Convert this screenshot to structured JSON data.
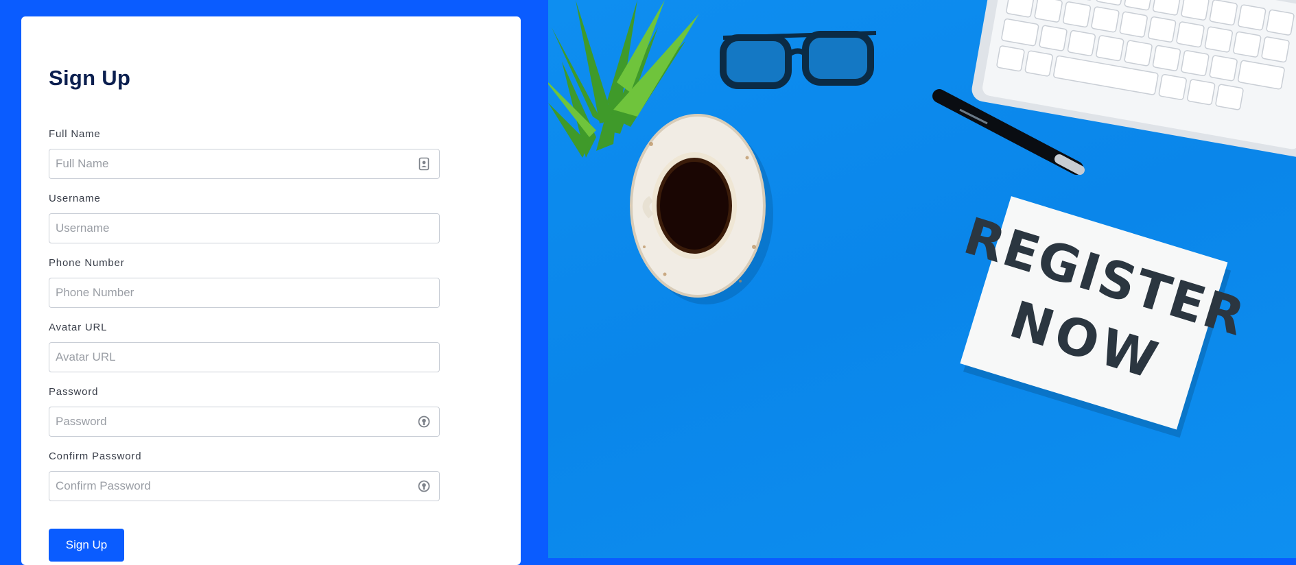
{
  "form": {
    "title": "Sign Up",
    "fields": [
      {
        "label": "Full Name",
        "placeholder": "Full Name",
        "icon": "contact-card-icon",
        "type": "text"
      },
      {
        "label": "Username",
        "placeholder": "Username",
        "icon": "",
        "type": "text"
      },
      {
        "label": "Phone Number",
        "placeholder": "Phone Number",
        "icon": "",
        "type": "text"
      },
      {
        "label": "Avatar URL",
        "placeholder": "Avatar URL",
        "icon": "",
        "type": "text"
      },
      {
        "label": "Password",
        "placeholder": "Password",
        "icon": "password-manager-icon",
        "type": "password"
      },
      {
        "label": "Confirm Password",
        "placeholder": "Confirm Password",
        "icon": "password-manager-icon",
        "type": "password"
      }
    ],
    "submit_label": "Sign Up"
  },
  "hero": {
    "note_line1": "REGISTER",
    "note_line2": "NOW"
  },
  "colors": {
    "brand": "#0a5cff",
    "hero_bg": "#0e8ef0",
    "title": "#0b1f4f"
  }
}
